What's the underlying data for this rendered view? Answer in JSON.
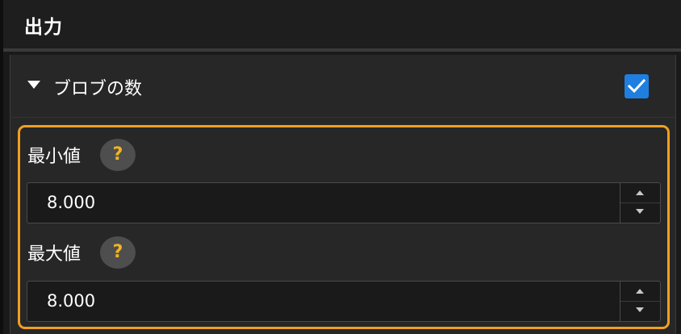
{
  "header": {
    "title": "出力"
  },
  "section": {
    "title": "ブロブの数",
    "expanded": true,
    "enabled": true
  },
  "fields": [
    {
      "label": "最小値",
      "value": "8.000",
      "help": "?"
    },
    {
      "label": "最大値",
      "value": "8.000",
      "help": "?"
    }
  ],
  "colors": {
    "background": "#1a1a1a",
    "panel": "#272727",
    "checkbox": "#1f7fe0",
    "highlight": "#f0a020",
    "help_mark": "#f2b324"
  }
}
